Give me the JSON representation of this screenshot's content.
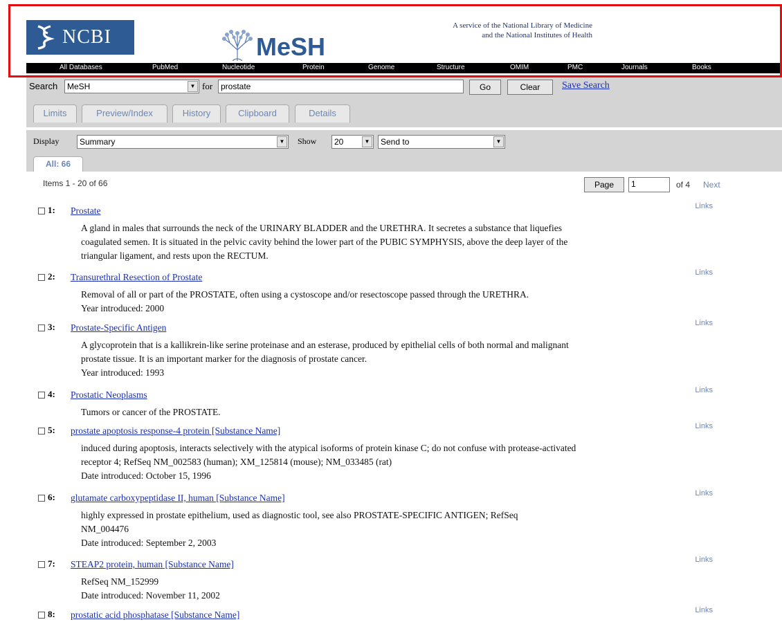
{
  "header": {
    "ncbi_logo_text": "NCBI",
    "mesh_logo_text": "MeSH",
    "service_line1": "A service of the National Library of Medicine",
    "service_line2": "and the National Institutes of Health"
  },
  "nav": {
    "items": [
      "All Databases",
      "PubMed",
      "Nucleotide",
      "Protein",
      "Genome",
      "Structure",
      "OMIM",
      "PMC",
      "Journals",
      "Books"
    ]
  },
  "search": {
    "search_label": "Search",
    "database": "MeSH",
    "for_label": "for",
    "query": "prostate",
    "go_label": "Go",
    "clear_label": "Clear",
    "save_search_label": "Save Search"
  },
  "tabs": [
    "Limits",
    "Preview/Index",
    "History",
    "Clipboard",
    "Details"
  ],
  "display": {
    "display_label": "Display",
    "format": "Summary",
    "show_label": "Show",
    "show_count": "20",
    "send_to": "Send to",
    "all_tab": "All: 66"
  },
  "pagination": {
    "items_text": "Items 1 - 20 of 66",
    "page_button": "Page",
    "page_value": "1",
    "of_text": "of 4",
    "next_label": "Next"
  },
  "results": [
    {
      "num": "1:",
      "title": "Prostate",
      "links": "Links",
      "lines": [
        "A gland in males that surrounds the neck of the URINARY BLADDER and the URETHRA. It secretes a substance that liquefies",
        "coagulated semen. It is situated in the pelvic cavity behind the lower part of the PUBIC SYMPHYSIS, above the deep layer of the",
        "triangular ligament, and rests upon the RECTUM."
      ]
    },
    {
      "num": "2:",
      "title": "Transurethral Resection of Prostate",
      "links": "Links",
      "lines": [
        "Removal of all or part of the PROSTATE, often using a cystoscope and/or resectoscope passed through the URETHRA.",
        "Year introduced: 2000"
      ]
    },
    {
      "num": "3:",
      "title": "Prostate-Specific Antigen",
      "links": "Links",
      "lines": [
        "A glycoprotein that is a kallikrein-like serine proteinase and an esterase, produced by epithelial cells of both normal and malignant",
        "prostate tissue. It is an important marker for the diagnosis of prostate cancer.",
        "Year introduced: 1993"
      ]
    },
    {
      "num": "4:",
      "title": "Prostatic Neoplasms",
      "links": "Links",
      "lines": [
        "Tumors or cancer of the PROSTATE."
      ]
    },
    {
      "num": "5:",
      "title": "prostate apoptosis response-4 protein [Substance Name]",
      "links": "Links",
      "lines": [
        "induced during apoptosis, interacts selectively with the atypical isoforms of protein kinase C; do not confuse with protease-activated",
        "receptor 4; RefSeq NM_002583 (human); XM_125814 (mouse); NM_033485 (rat)",
        "Date introduced: October 15, 1996"
      ]
    },
    {
      "num": "6:",
      "title": "glutamate carboxypeptidase II, human [Substance Name]",
      "links": "Links",
      "lines": [
        "highly expressed in prostate epithelium, used as diagnostic tool, see also PROSTATE-SPECIFIC ANTIGEN; RefSeq",
        "NM_004476",
        "Date introduced: September 2, 2003"
      ]
    },
    {
      "num": "7:",
      "title": "STEAP2 protein, human [Substance Name]",
      "links": "Links",
      "lines": [
        "RefSeq NM_152999",
        "Date introduced: November 11, 2002"
      ]
    },
    {
      "num": "8:",
      "title": "prostatic acid phosphatase [Substance Name]",
      "links": "Links",
      "lines": []
    }
  ]
}
